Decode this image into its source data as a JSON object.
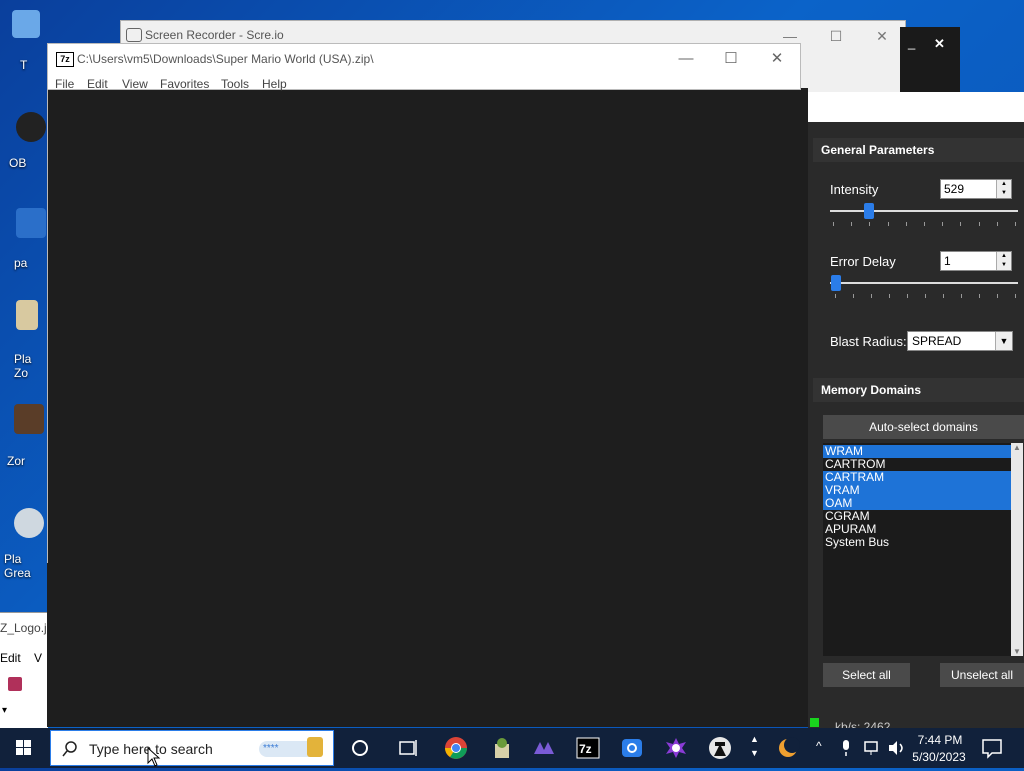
{
  "desktop": {
    "icons": [
      {
        "label": "T"
      },
      {
        "label": "OB"
      },
      {
        "label": "pa"
      },
      {
        "label": "Pla Zo"
      },
      {
        "label": "Zor"
      },
      {
        "label": "Pla Grea"
      }
    ]
  },
  "background_window": {
    "title": "Z_Logo.jp",
    "menu": [
      "Edit",
      "V"
    ]
  },
  "recorder": {
    "title": "Screen Recorder - Scre.io"
  },
  "zip_window": {
    "logo": "7z",
    "title": "C:\\Users\\vm5\\Downloads\\Super Mario World (USA).zip\\",
    "menu": [
      "File",
      "Edit",
      "View",
      "Favorites",
      "Tools",
      "Help"
    ]
  },
  "rtc": {
    "general": {
      "title": "General Parameters",
      "intensity_label": "Intensity",
      "intensity_value": "529",
      "intensity_slider_level": 0.11,
      "error_delay_label": "Error Delay",
      "error_delay_value": "1",
      "error_delay_slider_level": 0.0,
      "blast_radius_label": "Blast Radius:",
      "blast_radius_value": "SPREAD"
    },
    "memory": {
      "title": "Memory Domains",
      "auto_select": "Auto-select domains",
      "domains": [
        {
          "name": "WRAM",
          "selected": true
        },
        {
          "name": "CARTROM",
          "selected": false
        },
        {
          "name": "CARTRAM",
          "selected": true
        },
        {
          "name": "VRAM",
          "selected": true
        },
        {
          "name": "OAM",
          "selected": true
        },
        {
          "name": "CGRAM",
          "selected": false
        },
        {
          "name": "APURAM",
          "selected": false
        },
        {
          "name": "System Bus",
          "selected": false
        }
      ],
      "select_all": "Select all",
      "unselect_all": "Unselect all"
    },
    "status_partial": "kb/s: 2462"
  },
  "taskbar": {
    "search_placeholder": "Type here to search",
    "time": "7:44 PM",
    "date": "5/30/2023",
    "app_icons": [
      "cortana-icon",
      "task-view-icon",
      "chrome-icon",
      "plant-app-icon",
      "bizhawk-icon",
      "7zip-icon",
      "screen-recorder-icon",
      "rtc-icon",
      "spy-app-icon"
    ],
    "tray_icons": [
      "network-icon",
      "volume-icon",
      "notification-icon"
    ],
    "colors": {
      "taskbar": "#11213b",
      "accent": "#1e73d7"
    }
  }
}
